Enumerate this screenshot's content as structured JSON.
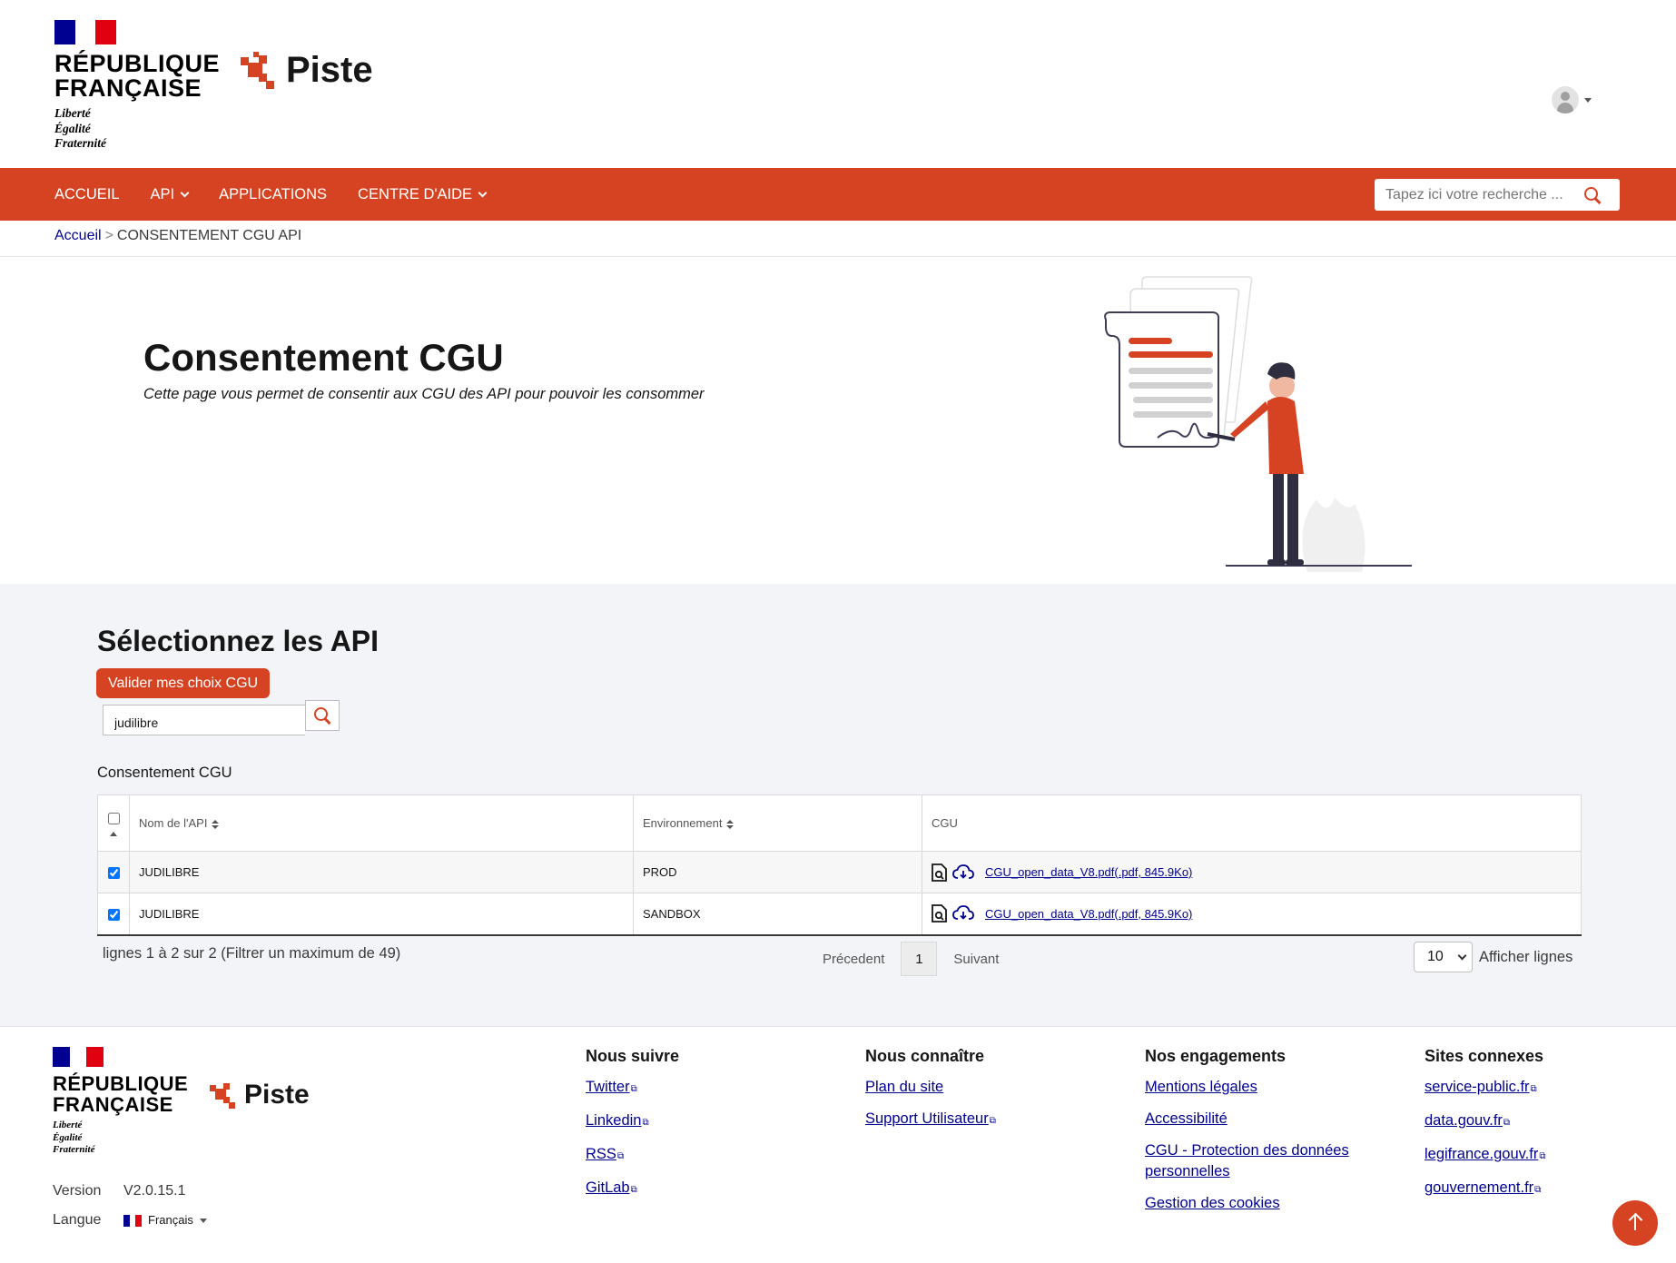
{
  "colors": {
    "accent": "#d64322",
    "link": "#000091",
    "section_bg": "#f3f4f7"
  },
  "header": {
    "republique": [
      "RÉPUBLIQUE",
      "FRANÇAISE"
    ],
    "motto": [
      "Liberté",
      "Égalité",
      "Fraternité"
    ],
    "brand": "Piste",
    "user_icon": "user-avatar-icon"
  },
  "nav": {
    "items": [
      {
        "label": "ACCUEIL",
        "dropdown": false
      },
      {
        "label": "API",
        "dropdown": true
      },
      {
        "label": "APPLICATIONS",
        "dropdown": false
      },
      {
        "label": "CENTRE D'AIDE",
        "dropdown": true
      }
    ],
    "search_placeholder": "Tapez ici votre recherche ..."
  },
  "breadcrumb": {
    "home": "Accueil",
    "separator": ">",
    "current": "CONSENTEMENT CGU API"
  },
  "hero": {
    "title": "Consentement CGU",
    "subtitle": "Cette page vous permet de consentir aux CGU des API pour pouvoir les consommer"
  },
  "selection": {
    "title": "Sélectionnez les API",
    "validate_button": "Valider mes choix CGU",
    "filter_value": "judilibre",
    "table_caption": "Consentement CGU",
    "columns": [
      "Nom de l'API",
      "Environnement",
      "CGU"
    ],
    "rows": [
      {
        "checked": true,
        "name": "JUDILIBRE",
        "env": "PROD",
        "cgu": "CGU_open_data_V8.pdf(.pdf, 845.9Ko)"
      },
      {
        "checked": true,
        "name": "JUDILIBRE",
        "env": "SANDBOX",
        "cgu": "CGU_open_data_V8.pdf(.pdf, 845.9Ko)"
      }
    ],
    "pagination": {
      "info": "lignes 1 à 2 sur 2 (Filtrer un maximum de 49)",
      "previous": "Précedent",
      "current_page": "1",
      "next": "Suivant",
      "page_size": "10",
      "page_size_label": "Afficher lignes"
    }
  },
  "footer": {
    "brand": "Piste",
    "version_label": "Version",
    "version": "V2.0.15.1",
    "language_label": "Langue",
    "language": "Français",
    "columns": [
      {
        "title": "Nous suivre",
        "links": [
          "Twitter",
          "Linkedin",
          "RSS",
          "GitLab"
        ]
      },
      {
        "title": "Nous connaître",
        "links": [
          "Plan du site",
          "Support Utilisateur"
        ]
      },
      {
        "title": "Nos engagements",
        "links": [
          "Mentions légales",
          "Accessibilité",
          "CGU - Protection des données personnelles",
          "Gestion des cookies"
        ]
      },
      {
        "title": "Sites connexes",
        "links": [
          "service-public.fr",
          "data.gouv.fr",
          "legifrance.gouv.fr",
          "gouvernement.fr"
        ]
      }
    ]
  }
}
